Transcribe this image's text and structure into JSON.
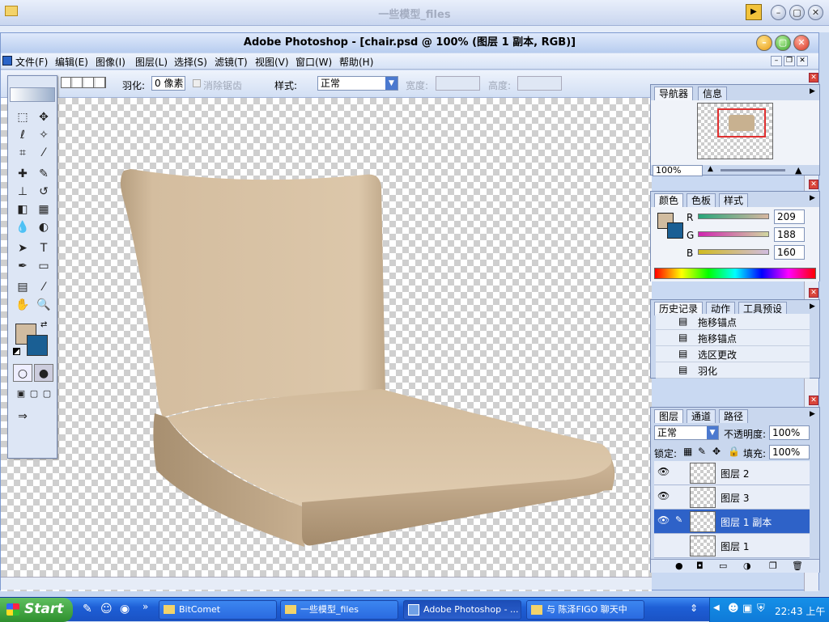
{
  "outer_window": {
    "title": "一些模型_files"
  },
  "ps": {
    "title": "Adobe Photoshop - [chair.psd @ 100% (图层 1 副本, RGB)]",
    "menus": [
      "文件(F)",
      "编辑(E)",
      "图像(I)",
      "图层(L)",
      "选择(S)",
      "滤镜(T)",
      "视图(V)",
      "窗口(W)",
      "帮助(H)"
    ],
    "options": {
      "feather_label": "羽化:",
      "feather_value": "0 像素",
      "antialias_label": "消除锯齿",
      "style_label": "样式:",
      "style_value": "正常",
      "width_label": "宽度:",
      "height_label": "高度:"
    },
    "navigator": {
      "tabs": [
        "导航器",
        "信息"
      ],
      "zoom": "100%"
    },
    "color": {
      "tabs": [
        "颜色",
        "色板",
        "样式"
      ],
      "r_label": "R",
      "r": "209",
      "g_label": "G",
      "g": "188",
      "b_label": "B",
      "b": "160",
      "foreground": "#d1bca0",
      "background": "#1a5f94"
    },
    "history": {
      "tabs": [
        "历史记录",
        "动作",
        "工具预设"
      ],
      "items": [
        "拖移锚点",
        "拖移锚点",
        "选区更改",
        "羽化"
      ]
    },
    "layers": {
      "tabs": [
        "图层",
        "通道",
        "路径"
      ],
      "blend_mode": "正常",
      "opacity_label": "不透明度:",
      "opacity": "100%",
      "lock_label": "锁定:",
      "fill_label": "填充:",
      "fill": "100%",
      "items": [
        "图层 2",
        "图层 3",
        "图层 1 副本",
        "图层 1"
      ]
    }
  },
  "taskbar": {
    "start": "Start",
    "tasks": [
      "BitComet",
      "一些模型_files",
      "Adobe Photoshop - ...",
      "与 陈泽FIGO 聊天中"
    ],
    "clock": "22:43 上午"
  }
}
